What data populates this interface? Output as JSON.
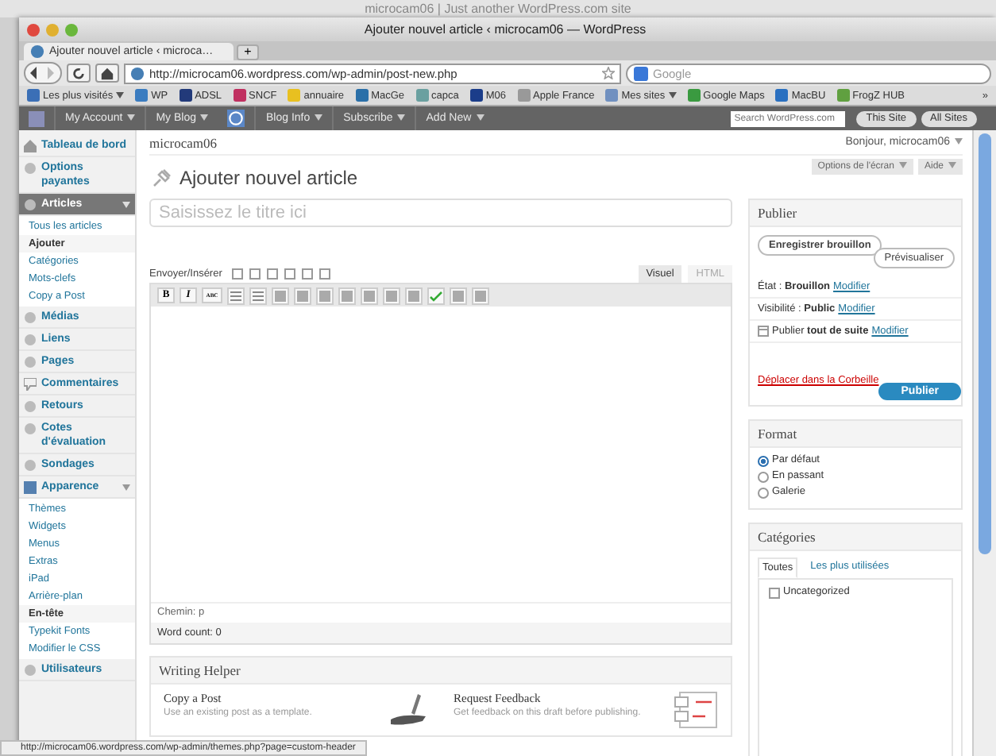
{
  "background_window": {
    "title": "microcam06 | Just another WordPress.com site"
  },
  "window": {
    "title": "Ajouter nouvel article ‹ microcam06 — WordPress"
  },
  "tabs": [
    {
      "label": "Ajouter nouvel article ‹ microca…",
      "selected": true
    }
  ],
  "new_tab_button": "+",
  "address_bar": {
    "url": "http://microcam06.wordpress.com/wp-admin/post-new.php"
  },
  "search_bar": {
    "placeholder": "Google"
  },
  "bookmarks": [
    {
      "label": "Les plus visités",
      "dropdown": true
    },
    {
      "label": "WP",
      "dropdown": false
    },
    {
      "label": "ADSL",
      "dropdown": false
    },
    {
      "label": "SNCF",
      "dropdown": false
    },
    {
      "label": "annuaire",
      "dropdown": false
    },
    {
      "label": "MacGe",
      "dropdown": false
    },
    {
      "label": "capca",
      "dropdown": false
    },
    {
      "label": "M06",
      "dropdown": false
    },
    {
      "label": "Apple France",
      "dropdown": false
    },
    {
      "label": "Mes sites",
      "dropdown": true
    },
    {
      "label": "Google Maps",
      "dropdown": false
    },
    {
      "label": "MacBU",
      "dropdown": false
    },
    {
      "label": "FrogZ HUB",
      "dropdown": false
    }
  ],
  "bookmarks_overflow": "»",
  "admin_bar": {
    "account_menus": [
      "My Account",
      "My Blog"
    ],
    "blog_menus": [
      "Blog Info",
      "Subscribe",
      "Add New"
    ],
    "search_placeholder": "Search WordPress.com",
    "buttons": [
      "This Site",
      "All Sites"
    ]
  },
  "sidebar": {
    "items": [
      {
        "label": "Tableau de bord",
        "selected": false,
        "expanded": false
      },
      {
        "label": "Options payantes",
        "selected": false,
        "expanded": false
      },
      {
        "label": "Articles",
        "selected": true,
        "expanded": true,
        "children": [
          {
            "label": "Tous les articles",
            "selected": false
          },
          {
            "label": "Ajouter",
            "selected": true
          },
          {
            "label": "Catégories",
            "selected": false
          },
          {
            "label": "Mots-clefs",
            "selected": false
          },
          {
            "label": "Copy a Post",
            "selected": false
          }
        ]
      },
      {
        "label": "Médias",
        "selected": false,
        "expanded": false
      },
      {
        "label": "Liens",
        "selected": false,
        "expanded": false
      },
      {
        "label": "Pages",
        "selected": false,
        "expanded": false
      },
      {
        "label": "Commentaires",
        "selected": false,
        "expanded": false
      },
      {
        "label": "Retours",
        "selected": false,
        "expanded": false
      },
      {
        "label": "Cotes d'évaluation",
        "selected": false,
        "expanded": false
      },
      {
        "label": "Sondages",
        "selected": false,
        "expanded": false
      },
      {
        "label": "Apparence",
        "selected": false,
        "expanded": true,
        "children": [
          {
            "label": "Thèmes",
            "selected": false
          },
          {
            "label": "Widgets",
            "selected": false
          },
          {
            "label": "Menus",
            "selected": false
          },
          {
            "label": "Extras",
            "selected": false
          },
          {
            "label": "iPad",
            "selected": false
          },
          {
            "label": "Arrière-plan",
            "selected": false
          },
          {
            "label": "En-tête",
            "selected": true
          },
          {
            "label": "Typekit Fonts",
            "selected": false
          },
          {
            "label": "Modifier le CSS",
            "selected": false
          }
        ]
      },
      {
        "label": "Utilisateurs",
        "selected": false,
        "expanded": false
      }
    ]
  },
  "site_header": {
    "site_name": "microcam06",
    "greeting": "Bonjour, microcam06"
  },
  "screen_tabs": [
    "Options de l'écran",
    "Aide"
  ],
  "page_title": "Ajouter nouvel article",
  "title_field": {
    "placeholder": "Saisissez le titre ici"
  },
  "editor": {
    "upload_label": "Envoyer/Insérer",
    "tabs": [
      {
        "label": "Visuel",
        "selected": true
      },
      {
        "label": "HTML",
        "selected": false
      }
    ],
    "format_buttons": [
      "B",
      "I",
      "ABC"
    ],
    "path": "Chemin: p",
    "word_count": "Word count: 0"
  },
  "writing_helper": {
    "title": "Writing Helper",
    "items": [
      {
        "title": "Copy a Post",
        "description": "Use an existing post as a template."
      },
      {
        "title": "Request Feedback",
        "description": "Get feedback on this draft before publishing."
      }
    ]
  },
  "publish_box": {
    "title": "Publier",
    "save_button": "Enregistrer brouillon",
    "preview_button": "Prévisualiser",
    "rows": [
      {
        "kind": "status",
        "text": "État : **Brouillon**",
        "link": "Modifier"
      },
      {
        "kind": "visibility",
        "text": "Visibilité : **Public**",
        "link": "Modifier"
      },
      {
        "kind": "schedule",
        "text": "Publier **tout de suite**",
        "link": "Modifier"
      }
    ],
    "trash_link": "Déplacer dans la Corbeille",
    "publish_button": "Publier"
  },
  "format_box": {
    "title": "Format",
    "options": [
      {
        "label": "Par défaut",
        "selected": true
      },
      {
        "label": "En passant",
        "selected": false
      },
      {
        "label": "Galerie",
        "selected": false
      }
    ]
  },
  "categories_box": {
    "title": "Catégories",
    "tabs": [
      {
        "label": "Toutes",
        "selected": true
      },
      {
        "label": "Les plus utilisées",
        "selected": false
      }
    ],
    "items": [
      {
        "label": "Uncategorized",
        "checked": false
      }
    ]
  },
  "status_bar": {
    "url": "http://microcam06.wordpress.com/wp-admin/themes.php?page=custom-header"
  }
}
